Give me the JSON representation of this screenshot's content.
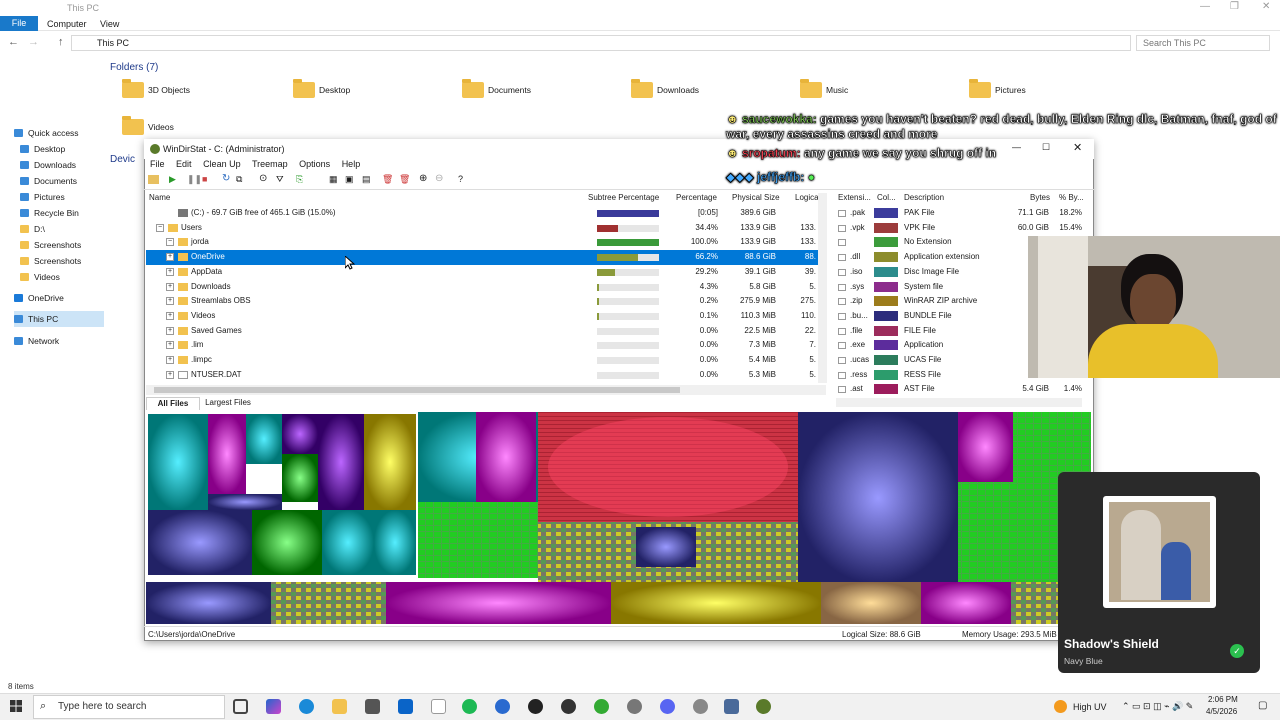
{
  "explorer": {
    "title": "This PC",
    "ribbon_tabs": [
      "File",
      "Computer",
      "View"
    ],
    "address": "This PC",
    "search_placeholder": "Search This PC",
    "nav": [
      {
        "label": "Quick access",
        "icon": "star-icon"
      },
      {
        "label": "Desktop",
        "icon": "desktop-icon"
      },
      {
        "label": "Downloads",
        "icon": "download-icon"
      },
      {
        "label": "Documents",
        "icon": "document-icon"
      },
      {
        "label": "Pictures",
        "icon": "pictures-icon"
      },
      {
        "label": "Recycle Bin",
        "icon": "recycle-bin-icon"
      },
      {
        "label": "D:\\",
        "icon": "folder-icon"
      },
      {
        "label": "Screenshots",
        "icon": "folder-icon"
      },
      {
        "label": "Screenshots",
        "icon": "folder-icon"
      },
      {
        "label": "Videos",
        "icon": "folder-icon"
      },
      {
        "label": "OneDrive",
        "icon": "cloud-icon"
      },
      {
        "label": "This PC",
        "icon": "computer-icon"
      },
      {
        "label": "Network",
        "icon": "network-icon"
      }
    ],
    "folders_header": "Folders (7)",
    "devices_header": "Devic",
    "folders": [
      "3D Objects",
      "Desktop",
      "Documents",
      "Downloads",
      "Music",
      "Pictures",
      "Videos"
    ],
    "status": "8 items"
  },
  "windirstat": {
    "title": "WinDirStat - C:  (Administrator)",
    "menu": [
      "File",
      "Edit",
      "Clean Up",
      "Treemap",
      "Options",
      "Help"
    ],
    "columns": {
      "name": "Name",
      "subtree": "Subtree Percentage",
      "pct": "Percentage",
      "physical": "Physical Size",
      "logical": "Logica"
    },
    "rows": [
      {
        "name": "(C:) - 69.7 GiB free of 465.1 GiB (15.0%)",
        "pct": "[0:05]",
        "physical": "389.6 GiB",
        "logical": "",
        "fill": 1.0,
        "color": "#3a3a9a",
        "indent": 0
      },
      {
        "name": "Users",
        "pct": "34.4%",
        "physical": "133.9 GiB",
        "logical": "133.",
        "fill": 0.34,
        "color": "#a03030",
        "indent": 1
      },
      {
        "name": "jorda",
        "pct": "100.0%",
        "physical": "133.9 GiB",
        "logical": "133.",
        "fill": 1.0,
        "color": "#3a9a3a",
        "indent": 2
      },
      {
        "name": "OneDrive",
        "pct": "66.2%",
        "physical": "88.6 GiB",
        "logical": "88.",
        "fill": 0.66,
        "color": "#8a9a3a",
        "indent": 3,
        "selected": true
      },
      {
        "name": "AppData",
        "pct": "29.2%",
        "physical": "39.1 GiB",
        "logical": "39.",
        "fill": 0.29,
        "color": "#8a9a3a",
        "indent": 3
      },
      {
        "name": "Downloads",
        "pct": "4.3%",
        "physical": "5.8 GiB",
        "logical": "5.",
        "fill": 0.04,
        "color": "#8a9a3a",
        "indent": 3
      },
      {
        "name": "Streamlabs OBS",
        "pct": "0.2%",
        "physical": "275.9 MiB",
        "logical": "275.",
        "fill": 0.0,
        "color": "#8a9a3a",
        "indent": 3
      },
      {
        "name": "Videos",
        "pct": "0.1%",
        "physical": "110.3 MiB",
        "logical": "110.",
        "fill": 0.0,
        "color": "#8a9a3a",
        "indent": 3
      },
      {
        "name": "Saved Games",
        "pct": "0.0%",
        "physical": "22.5 MiB",
        "logical": "22.",
        "fill": 0.0,
        "color": "#8a9a3a",
        "indent": 3
      },
      {
        "name": ".lim",
        "pct": "0.0%",
        "physical": "7.3 MiB",
        "logical": "7.",
        "fill": 0.0,
        "color": "#8a9a3a",
        "indent": 3
      },
      {
        "name": ".limpc",
        "pct": "0.0%",
        "physical": "5.4 MiB",
        "logical": "5.",
        "fill": 0.0,
        "color": "#8a9a3a",
        "indent": 3
      },
      {
        "name": "NTUSER.DAT",
        "pct": "0.0%",
        "physical": "5.3 MiB",
        "logical": "5.",
        "fill": 0.0,
        "color": "#8a9a3a",
        "indent": 3,
        "file": true
      }
    ],
    "ext_columns": {
      "ext": "Extensi...",
      "color": "Col...",
      "desc": "Description",
      "bytes": "Bytes",
      "pct": "% By..."
    },
    "extensions": [
      {
        "ext": ".pak",
        "color": "#3c3c9c",
        "desc": "PAK File",
        "bytes": "71.1 GiB",
        "pct": "18.2%"
      },
      {
        "ext": ".vpk",
        "color": "#9c3c3c",
        "desc": "VPK File",
        "bytes": "60.0 GiB",
        "pct": "15.4%"
      },
      {
        "ext": "",
        "color": "#3c9c3c",
        "desc": "No Extension",
        "bytes": "",
        "pct": ""
      },
      {
        "ext": ".dll",
        "color": "#8c8c2c",
        "desc": "Application extension",
        "bytes": "",
        "pct": ""
      },
      {
        "ext": ".iso",
        "color": "#2c8c8c",
        "desc": "Disc Image File",
        "bytes": "",
        "pct": ""
      },
      {
        "ext": ".sys",
        "color": "#8c2c8c",
        "desc": "System file",
        "bytes": "",
        "pct": ""
      },
      {
        "ext": ".zip",
        "color": "#9c7c1c",
        "desc": "WinRAR ZIP archive",
        "bytes": "",
        "pct": ""
      },
      {
        "ext": ".bu...",
        "color": "#2c2c7c",
        "desc": "BUNDLE File",
        "bytes": "",
        "pct": ""
      },
      {
        "ext": ".file",
        "color": "#9c2c5c",
        "desc": "FILE File",
        "bytes": "",
        "pct": ""
      },
      {
        "ext": ".exe",
        "color": "#5c2c9c",
        "desc": "Application",
        "bytes": "",
        "pct": ""
      },
      {
        "ext": ".ucas",
        "color": "#2c7c5c",
        "desc": "UCAS File",
        "bytes": "",
        "pct": ""
      },
      {
        "ext": ".ress",
        "color": "#2c9c6c",
        "desc": "RESS File",
        "bytes": "",
        "pct": ""
      },
      {
        "ext": ".ast",
        "color": "#9c1c5c",
        "desc": "AST File",
        "bytes": "5.4 GiB",
        "pct": "1.4%"
      }
    ],
    "tabs": [
      "All Files",
      "Largest Files"
    ],
    "status_path": "C:\\Users\\jorda\\OneDrive",
    "status_logical": "Logical Size: 88.6 GiB",
    "status_memory": "Memory Usage: 293.5 MiB"
  },
  "chat": [
    {
      "user": "saucewokka:",
      "msg": "games you haven't beaten? red dead, bully, Elden Ring dlc, Batman, fnaf, god of war, every assassins creed and more"
    },
    {
      "user": "sropatum:",
      "msg": "any game we say you shrug off in"
    },
    {
      "user": "jeffjeffb:",
      "msg": ""
    }
  ],
  "alert": {
    "title": "Shadow's Shield",
    "subtitle": "Navy Blue"
  },
  "taskbar": {
    "search_placeholder": "Type here to search",
    "weather": "High UV",
    "time": "2:06 PM",
    "date": "4/5/2026"
  }
}
